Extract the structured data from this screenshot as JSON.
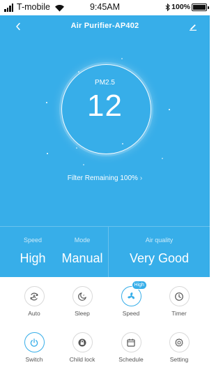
{
  "status_bar": {
    "carrier": "T-mobile",
    "time": "9:45AM",
    "battery_percent": "100%",
    "battery_level": 1.0,
    "icons": [
      "signal-icon",
      "wifi-icon",
      "bluetooth-icon",
      "battery-icon"
    ]
  },
  "header": {
    "title": "Air Purifier-AP402",
    "back_icon": "chevron-left-icon",
    "edit_icon": "pencil-icon"
  },
  "air": {
    "pm_label": "PM2.5",
    "pm_value": "12",
    "filter_text": "Filter Remaining 100%",
    "filter_chevron": "›"
  },
  "stats": {
    "speed_label": "Speed",
    "speed_value": "High",
    "mode_label": "Mode",
    "mode_value": "Manual",
    "air_label": "Air quality",
    "air_value": "Very Good"
  },
  "controls": {
    "auto": "Auto",
    "sleep": "Sleep",
    "speed": "Speed",
    "speed_badge": "High",
    "timer": "Timer",
    "switch": "Switch",
    "child_lock": "Child lock",
    "schedule": "Schedule",
    "setting": "Setting"
  },
  "colors": {
    "primary": "#37aee9",
    "white": "#ffffff",
    "icon_gray": "#555555"
  }
}
